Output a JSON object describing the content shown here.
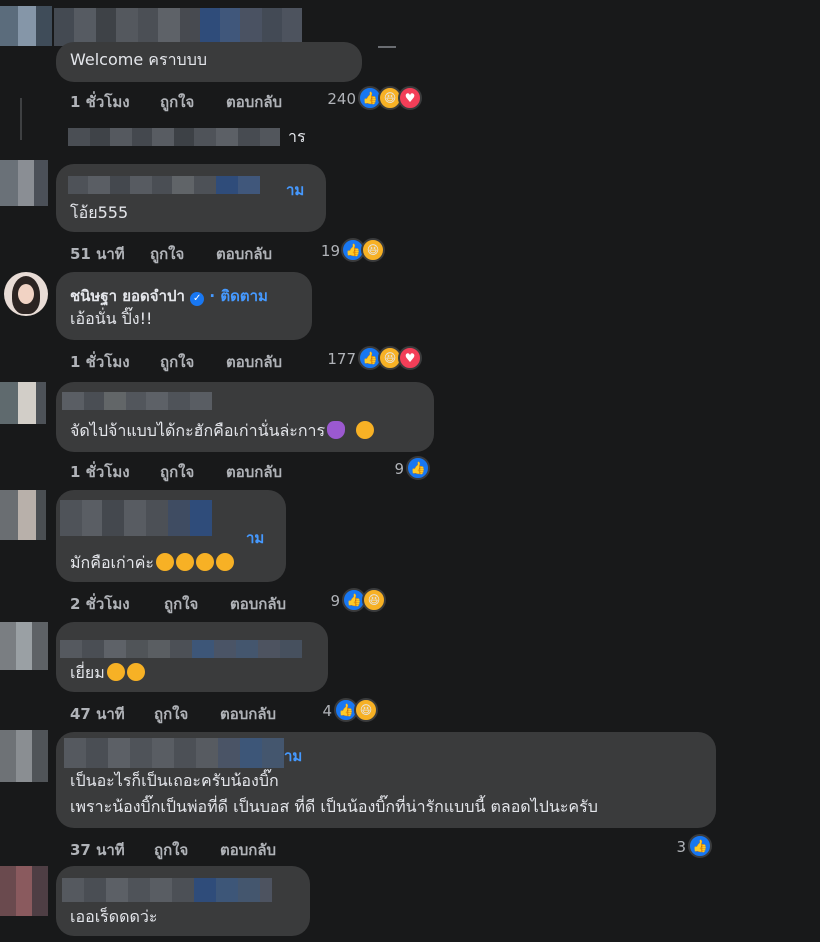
{
  "actions": {
    "like": "ถูกใจ",
    "reply": "ตอบกลับ"
  },
  "comments": [
    {
      "text": "Welcome คราบบบ",
      "time": "1 ชั่วโมง",
      "count": "240"
    },
    {
      "partial_text": "าร",
      "name_fragment": "าม",
      "text": "โอ้ย555",
      "time": "51 นาที",
      "count": "19"
    },
    {
      "name": "ชนิษฐา ยอดจำปา",
      "follow": "· ติดตาม",
      "text": "เอ้อนั่น ปิ๊ง!!",
      "time": "1 ชั่วโมง",
      "count": "177"
    },
    {
      "text": "จัดไปจ้าแบบได้กะฮักคือเก่านั่นล่ะการ",
      "time": "1 ชั่วโมง",
      "count": "9"
    },
    {
      "name_fragment": "าม",
      "text": "มักคือเก่าค่ะ",
      "time": "2 ชั่วโมง",
      "count": "9"
    },
    {
      "text": "เยี่ยม",
      "time": "47 นาที",
      "count": "4"
    },
    {
      "name_fragment": "าม",
      "text_line1": "เป็นอะไรก็เป็นเถอะครับน้องบิ๊ก",
      "text_line2": "เพราะน้องบิ๊กเป็นพ่อที่ดี เป็นบอส ที่ดี เป็นน้องบิ๊กที่น่ารักแบบนี้ ตลอดไปนะครับ",
      "time": "37 นาที",
      "count": "3"
    },
    {
      "text": "เออเร็ดดดว่ะ"
    }
  ],
  "icons": {
    "like": "like-icon",
    "haha": "haha-icon",
    "love": "love-icon",
    "verified": "verified-icon"
  },
  "colors": {
    "background": "#18191a",
    "bubble": "#3a3b3c",
    "link": "#4599ff",
    "like": "#1877f2"
  }
}
